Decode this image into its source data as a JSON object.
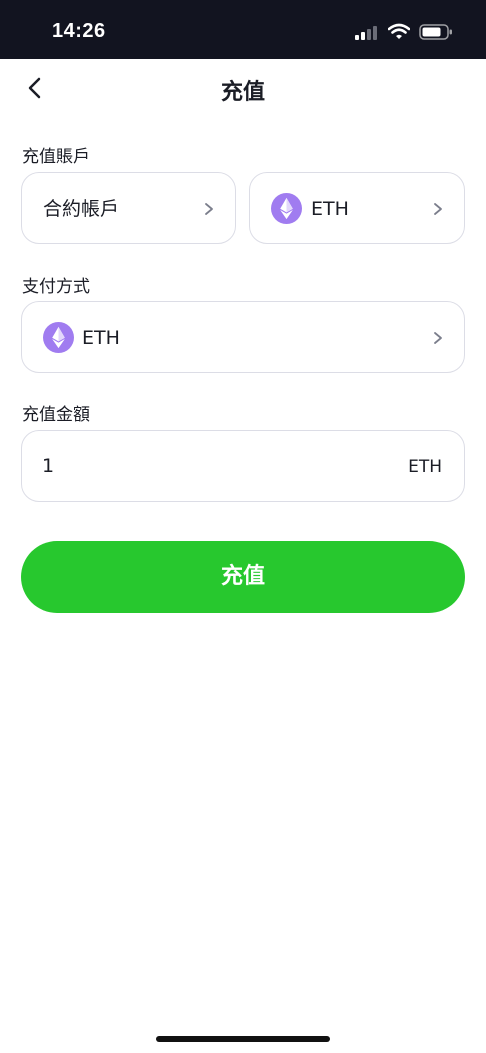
{
  "status_bar": {
    "time": "14:26",
    "icons": [
      "signal-icon",
      "wifi-icon",
      "battery-icon"
    ]
  },
  "header": {
    "title": "充值",
    "back_icon": "chevron-left-icon"
  },
  "deposit_account": {
    "label": "充值賬戶",
    "account_value": "合約帳戶",
    "coin_value": "ETH"
  },
  "payment_method": {
    "label": "支付方式",
    "value": "ETH"
  },
  "amount": {
    "label": "充值金額",
    "value": "1",
    "unit": "ETH"
  },
  "submit": {
    "label": "充值"
  },
  "colors": {
    "status_bar_bg": "#121420",
    "primary_green": "#27c82e",
    "eth_purple": "#a07cf0",
    "card_border": "#dcdde6"
  }
}
